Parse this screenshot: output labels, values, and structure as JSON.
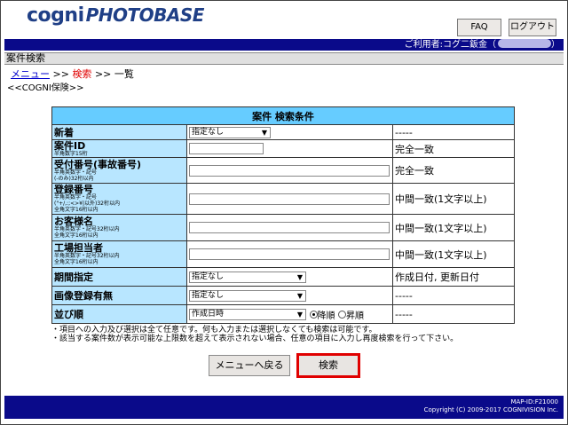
{
  "header": {
    "logo_cogni": "cogni",
    "logo_photobase": "PHOTOBASE",
    "faq_label": "FAQ",
    "logout_label": "ログアウト"
  },
  "userbar": {
    "user_prefix": "ご利用者:コグ二鈑金（",
    "user_suffix": "）"
  },
  "section_title": "案件検索",
  "breadcrumb": {
    "menu_label": "メニュー",
    "sep1": ">>",
    "current_label": "検索",
    "sep2": ">>",
    "list_label": "一覧"
  },
  "subheading": "<<COGNI保険>>",
  "search": {
    "header": "案件 検索条件",
    "rows": [
      {
        "label": "新着",
        "note": "",
        "control": "select",
        "value": "指定なし",
        "condition": "-----"
      },
      {
        "label": "案件ID",
        "note": "半角数字15桁",
        "control": "text",
        "value": "",
        "condition": "完全一致"
      },
      {
        "label": "受付番号(事故番号)",
        "note": "半角英数字・記号\n(-のみ)32桁以内",
        "control": "text",
        "value": "",
        "condition": "完全一致"
      },
      {
        "label": "登録番号",
        "note": "半角英数字・記号\n(\"+/,:;<>¥|以外)32桁以内\n全角文字16桁以内",
        "control": "text",
        "value": "",
        "condition": "中間一致(1文字以上)"
      },
      {
        "label": "お客様名",
        "note": "半角英数字・記号32桁以内\n全角文字16桁以内",
        "control": "text",
        "value": "",
        "condition": "中間一致(1文字以上)"
      },
      {
        "label": "工場担当者",
        "note": "半角英数字・記号32桁以内\n全角文字16桁以内",
        "control": "text",
        "value": "",
        "condition": "中間一致(1文字以上)"
      },
      {
        "label": "期間指定",
        "note": "",
        "control": "select",
        "value": "指定なし",
        "condition": "作成日付, 更新日付"
      },
      {
        "label": "画像登録有無",
        "note": "",
        "control": "select",
        "value": "指定なし",
        "condition": "-----"
      },
      {
        "label": "並び順",
        "note": "",
        "control": "select",
        "value": "作成日時",
        "condition": "-----"
      }
    ],
    "sort_desc_label": "降順",
    "sort_asc_label": "昇順",
    "sort_selected": "desc"
  },
  "notes": [
    "・項目への入力及び選択は全て任意です。何も入力または選択しなくても検索は可能です。",
    "・該当する案件数が表示可能な上限数を超えて表示されない場合、任意の項目に入力し再度検索を行って下さい。"
  ],
  "buttons": {
    "back_label": "メニューへ戻る",
    "search_label": "検索"
  },
  "footer": {
    "page_id": "MAP-ID:F21000",
    "copyright": "Copyright (C) 2009-2017 COGNIVISION Inc."
  }
}
